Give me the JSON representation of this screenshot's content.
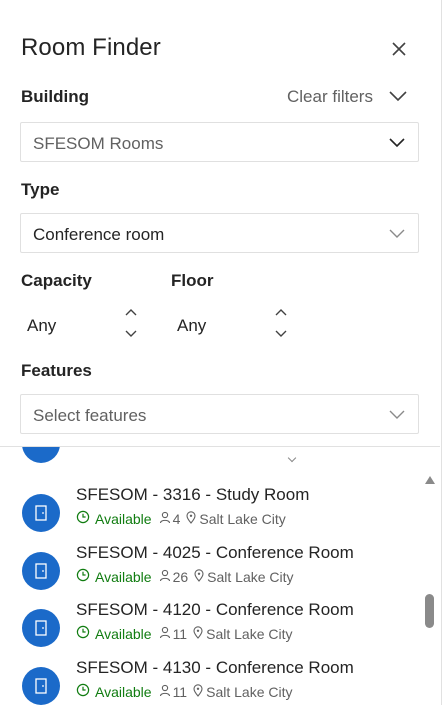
{
  "header": {
    "title": "Room Finder",
    "close_icon": "close-icon"
  },
  "filters": {
    "building_label": "Building",
    "clear_filters": "Clear filters",
    "building_value": "SFESOM Rooms",
    "type_label": "Type",
    "type_value": "Conference room",
    "capacity_label": "Capacity",
    "capacity_value": "Any",
    "floor_label": "Floor",
    "floor_value": "Any",
    "features_label": "Features",
    "features_placeholder": "Select features"
  },
  "rooms": [
    {
      "name": "SFESOM - 3316 - Study Room",
      "status": "Available",
      "capacity": "4",
      "location": "Salt Lake City"
    },
    {
      "name": "SFESOM - 4025 - Conference Room",
      "status": "Available",
      "capacity": "26",
      "location": "Salt Lake City"
    },
    {
      "name": "SFESOM - 4120 - Conference Room",
      "status": "Available",
      "capacity": "11",
      "location": "Salt Lake City"
    },
    {
      "name": "SFESOM - 4130 - Conference Room",
      "status": "Available",
      "capacity": "11",
      "location": "Salt Lake City"
    }
  ],
  "colors": {
    "accent": "#1b6ac9",
    "available": "#107c10",
    "muted": "#616161"
  }
}
